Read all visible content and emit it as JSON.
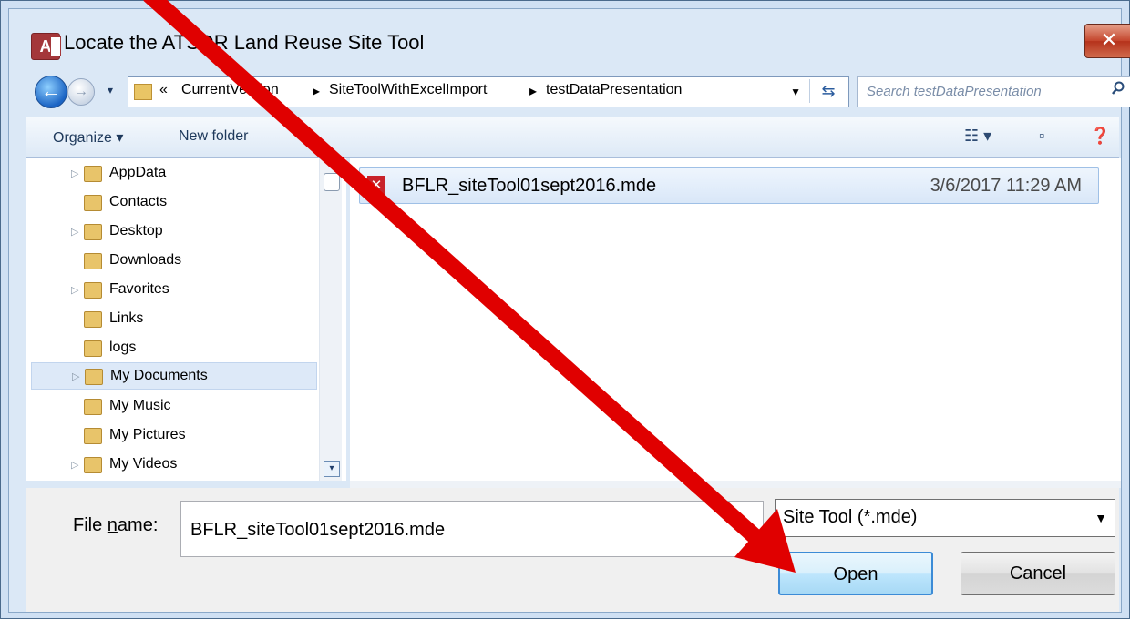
{
  "dialog": {
    "title": "Locate the ATSDR Land Reuse Site Tool",
    "app_icon_letter": "A",
    "close_symbol": "✕"
  },
  "address_bar": {
    "overflow": "«",
    "crumbs": [
      "CurrentVersion",
      "SiteToolWithExcelImport",
      "testDataPresentation"
    ],
    "separator": "▸",
    "search_placeholder": "Search testDataPresentation"
  },
  "toolbar": {
    "organize_label": "Organize",
    "new_folder_label": "New folder"
  },
  "nav_tree": [
    {
      "label": "AppData",
      "expandable": true
    },
    {
      "label": "Contacts",
      "expandable": false
    },
    {
      "label": "Desktop",
      "expandable": true
    },
    {
      "label": "Downloads",
      "expandable": false
    },
    {
      "label": "Favorites",
      "expandable": true
    },
    {
      "label": "Links",
      "expandable": false
    },
    {
      "label": "logs",
      "expandable": false
    },
    {
      "label": "My Documents",
      "expandable": true,
      "selected": true
    },
    {
      "label": "My Music",
      "expandable": false
    },
    {
      "label": "My Pictures",
      "expandable": false
    },
    {
      "label": "My Videos",
      "expandable": true
    }
  ],
  "files": [
    {
      "name": "BFLR_siteTool01sept2016.mde",
      "date": "3/6/2017 11:29 AM"
    }
  ],
  "footer": {
    "file_name_label_pre": "File ",
    "file_name_label_accel": "n",
    "file_name_label_post": "ame:",
    "file_name_value": "BFLR_siteTool01sept2016.mde",
    "filter_value": "Site Tool (*.mde)",
    "open_label": "Open",
    "cancel_label": "Cancel"
  },
  "annotation": {
    "arrow_color": "#e00000"
  }
}
